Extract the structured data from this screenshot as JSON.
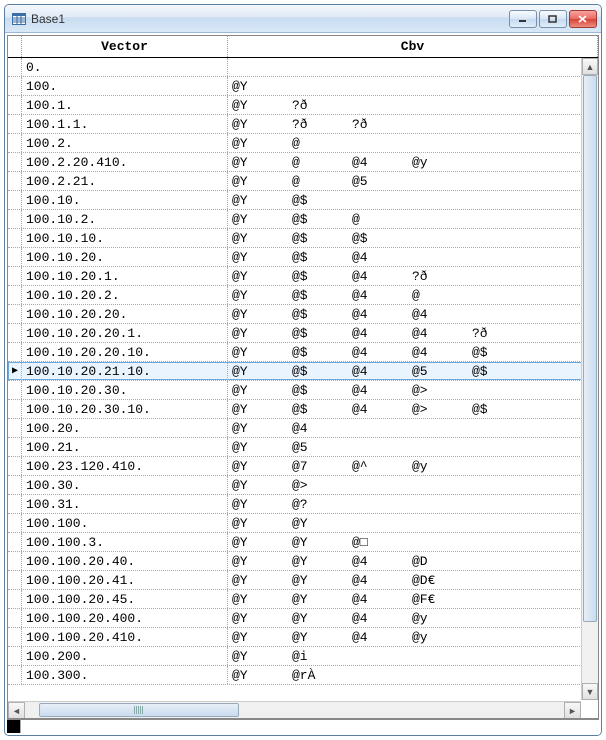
{
  "window": {
    "title": "Base1"
  },
  "headers": {
    "vector": "Vector",
    "cbv": "Cbv"
  },
  "selected_row_index": 16,
  "rows": [
    {
      "vector": "0.",
      "cbv": []
    },
    {
      "vector": "100.",
      "cbv": [
        "@Y"
      ]
    },
    {
      "vector": "100.1.",
      "cbv": [
        "@Y",
        "?ð"
      ]
    },
    {
      "vector": "100.1.1.",
      "cbv": [
        "@Y",
        "?ð",
        "?ð"
      ]
    },
    {
      "vector": "100.2.",
      "cbv": [
        "@Y",
        "@"
      ]
    },
    {
      "vector": "100.2.20.410.",
      "cbv": [
        "@Y",
        "@",
        "@4",
        "@y"
      ]
    },
    {
      "vector": "100.2.21.",
      "cbv": [
        "@Y",
        "@",
        "@5"
      ]
    },
    {
      "vector": "100.10.",
      "cbv": [
        "@Y",
        "@$"
      ]
    },
    {
      "vector": "100.10.2.",
      "cbv": [
        "@Y",
        "@$",
        "@"
      ]
    },
    {
      "vector": "100.10.10.",
      "cbv": [
        "@Y",
        "@$",
        "@$"
      ]
    },
    {
      "vector": "100.10.20.",
      "cbv": [
        "@Y",
        "@$",
        "@4"
      ]
    },
    {
      "vector": "100.10.20.1.",
      "cbv": [
        "@Y",
        "@$",
        "@4",
        "?ð"
      ]
    },
    {
      "vector": "100.10.20.2.",
      "cbv": [
        "@Y",
        "@$",
        "@4",
        "@"
      ]
    },
    {
      "vector": "100.10.20.20.",
      "cbv": [
        "@Y",
        "@$",
        "@4",
        "@4"
      ]
    },
    {
      "vector": "100.10.20.20.1.",
      "cbv": [
        "@Y",
        "@$",
        "@4",
        "@4",
        "?ð"
      ]
    },
    {
      "vector": "100.10.20.20.10.",
      "cbv": [
        "@Y",
        "@$",
        "@4",
        "@4",
        "@$"
      ]
    },
    {
      "vector": "100.10.20.21.10.",
      "cbv": [
        "@Y",
        "@$",
        "@4",
        "@5",
        "@$"
      ]
    },
    {
      "vector": "100.10.20.30.",
      "cbv": [
        "@Y",
        "@$",
        "@4",
        "@>"
      ]
    },
    {
      "vector": "100.10.20.30.10.",
      "cbv": [
        "@Y",
        "@$",
        "@4",
        "@>",
        "@$"
      ]
    },
    {
      "vector": "100.20.",
      "cbv": [
        "@Y",
        "@4"
      ]
    },
    {
      "vector": "100.21.",
      "cbv": [
        "@Y",
        "@5"
      ]
    },
    {
      "vector": "100.23.120.410.",
      "cbv": [
        "@Y",
        "@7",
        "@^",
        "@y"
      ]
    },
    {
      "vector": "100.30.",
      "cbv": [
        "@Y",
        "@>"
      ]
    },
    {
      "vector": "100.31.",
      "cbv": [
        "@Y",
        "@?"
      ]
    },
    {
      "vector": "100.100.",
      "cbv": [
        "@Y",
        "@Y"
      ]
    },
    {
      "vector": "100.100.3.",
      "cbv": [
        "@Y",
        "@Y",
        "@□"
      ]
    },
    {
      "vector": "100.100.20.40.",
      "cbv": [
        "@Y",
        "@Y",
        "@4",
        "@D"
      ]
    },
    {
      "vector": "100.100.20.41.",
      "cbv": [
        "@Y",
        "@Y",
        "@4",
        "@D€"
      ]
    },
    {
      "vector": "100.100.20.45.",
      "cbv": [
        "@Y",
        "@Y",
        "@4",
        "@F€"
      ]
    },
    {
      "vector": "100.100.20.400.",
      "cbv": [
        "@Y",
        "@Y",
        "@4",
        "@y"
      ]
    },
    {
      "vector": "100.100.20.410.",
      "cbv": [
        "@Y",
        "@Y",
        "@4",
        "@y"
      ]
    },
    {
      "vector": "100.200.",
      "cbv": [
        "@Y",
        "@i"
      ]
    },
    {
      "vector": "100.300.",
      "cbv": [
        "@Y",
        "@rÀ"
      ]
    }
  ]
}
